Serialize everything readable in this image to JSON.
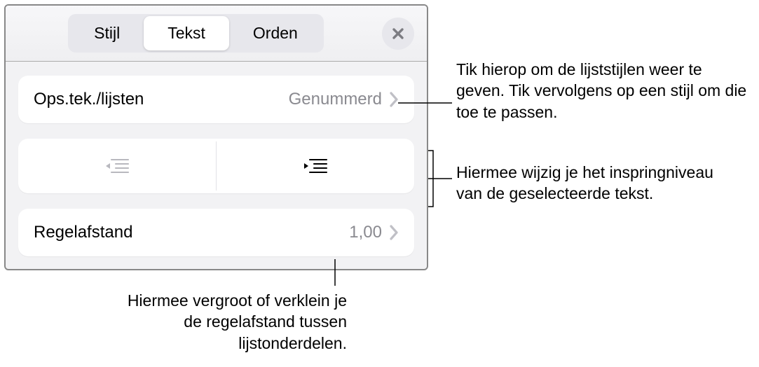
{
  "header": {
    "tabs": {
      "stijl": "Stijl",
      "tekst": "Tekst",
      "orden": "Orden"
    }
  },
  "rows": {
    "bullets": {
      "label": "Ops.tek./lijsten",
      "value": "Genummerd"
    },
    "spacing": {
      "label": "Regelafstand",
      "value": "1,00"
    }
  },
  "callouts": {
    "c1": "Tik hierop om de lijststijlen weer te geven. Tik vervolgens op een stijl om die toe te passen.",
    "c2": "Hiermee wijzig je het inspringniveau van de geselecteerde tekst.",
    "c3": "Hiermee vergroot of verklein je de regelafstand tussen lijstonderdelen."
  }
}
